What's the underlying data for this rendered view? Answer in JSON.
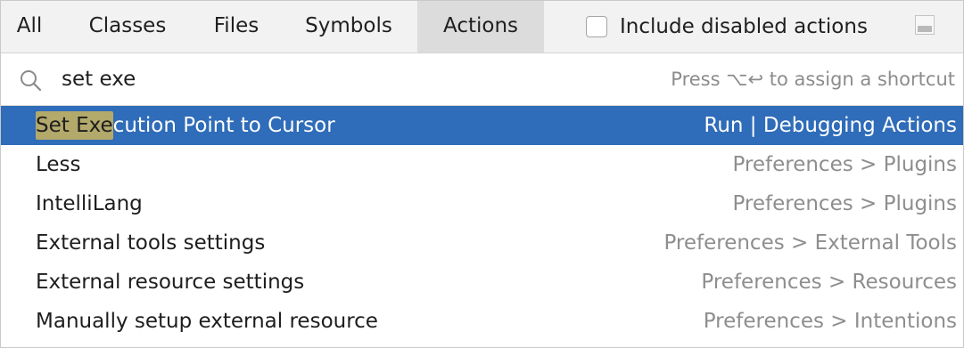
{
  "tabs": [
    {
      "label": "All",
      "active": false
    },
    {
      "label": "Classes",
      "active": false
    },
    {
      "label": "Files",
      "active": false
    },
    {
      "label": "Symbols",
      "active": false
    },
    {
      "label": "Actions",
      "active": true
    }
  ],
  "include_disabled": {
    "label": "Include disabled actions",
    "checked": false
  },
  "search": {
    "value": "set exe",
    "icon": "search-icon",
    "hint_prefix": "Press",
    "hint_keys": "⌥↩",
    "hint_suffix": "to assign a shortcut"
  },
  "results": [
    {
      "match": "Set Exe",
      "rest": "cution Point to Cursor",
      "location": "Run | Debugging Actions",
      "selected": true
    },
    {
      "match": "",
      "rest": "Less",
      "location": "Preferences > Plugins",
      "selected": false
    },
    {
      "match": "",
      "rest": "IntelliLang",
      "location": "Preferences > Plugins",
      "selected": false
    },
    {
      "match": "",
      "rest": "External tools settings",
      "location": "Preferences > External Tools",
      "selected": false
    },
    {
      "match": "",
      "rest": "External resource settings",
      "location": "Preferences > Resources",
      "selected": false
    },
    {
      "match": "",
      "rest": "Manually setup external resource",
      "location": "Preferences > Intentions",
      "selected": false
    }
  ],
  "colors": {
    "selection": "#2f6cb9",
    "match_highlight": "#b2a96b",
    "tab_bar": "#f2f2f2",
    "active_tab": "#dcdcdc"
  }
}
